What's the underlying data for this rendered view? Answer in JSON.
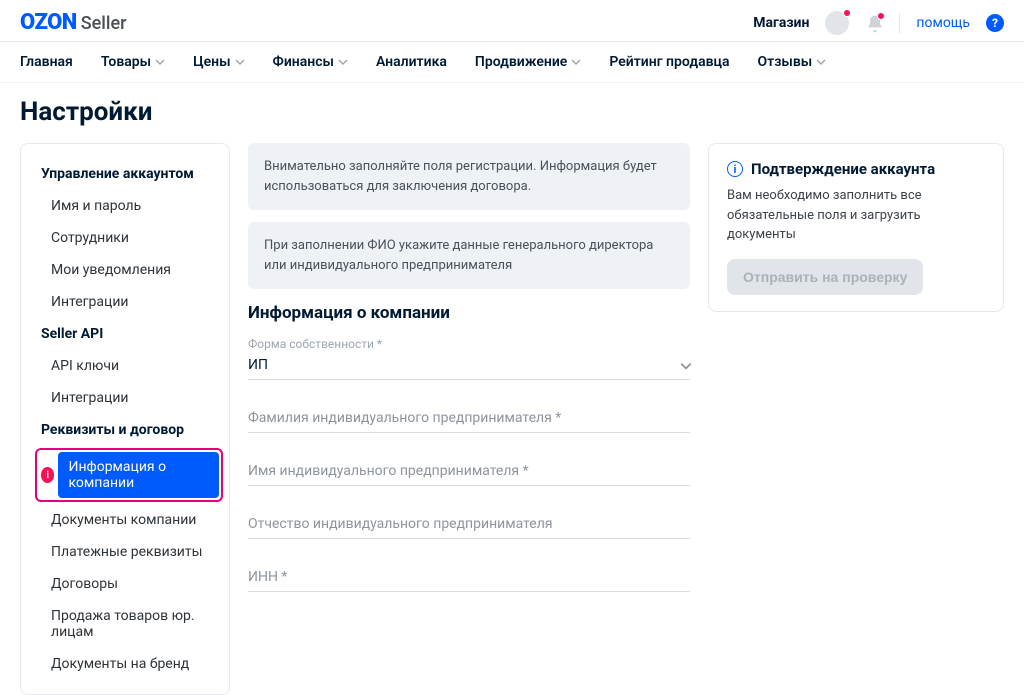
{
  "header": {
    "logo_brand": "OZON",
    "logo_sub": "Seller",
    "shop_label": "Магазин",
    "help_label": "помощь"
  },
  "nav": {
    "items": [
      {
        "label": "Главная",
        "dropdown": false
      },
      {
        "label": "Товары",
        "dropdown": true
      },
      {
        "label": "Цены",
        "dropdown": true
      },
      {
        "label": "Финансы",
        "dropdown": true
      },
      {
        "label": "Аналитика",
        "dropdown": false
      },
      {
        "label": "Продвижение",
        "dropdown": true
      },
      {
        "label": "Рейтинг продавца",
        "dropdown": false
      },
      {
        "label": "Отзывы",
        "dropdown": true
      }
    ]
  },
  "page_title": "Настройки",
  "sidebar": {
    "sections": [
      {
        "title": "Управление аккаунтом",
        "items": [
          "Имя и пароль",
          "Сотрудники",
          "Мои уведомления",
          "Интеграции"
        ]
      },
      {
        "title": "Seller API",
        "items": [
          "API ключи",
          "Интеграции"
        ]
      },
      {
        "title": "Реквизиты и договор",
        "items": [
          "Информация о компании",
          "Документы компании",
          "Платежные реквизиты",
          "Договоры",
          "Продажа товаров юр. лицам",
          "Документы на бренд"
        ]
      }
    ]
  },
  "main": {
    "notice1": "Внимательно заполняйте поля регистрации. Информация будет использоваться для заключения договора.",
    "notice2": "При заполнении ФИО укажите данные генерального директора или индивидуального предпринимателя",
    "section_title": "Информация о компании",
    "fields": {
      "ownership_label": "Форма собственности *",
      "ownership_value": "ИП",
      "lastname_label": "Фамилия индивидуального предпринимателя *",
      "firstname_label": "Имя индивидуального предпринимателя *",
      "patronymic_label": "Отчество индивидуального предпринимателя",
      "inn_label": "ИНН *"
    }
  },
  "right_panel": {
    "title": "Подтверждение аккаунта",
    "text": "Вам необходимо заполнить все обязательные поля и загрузить документы",
    "button": "Отправить на проверку"
  }
}
